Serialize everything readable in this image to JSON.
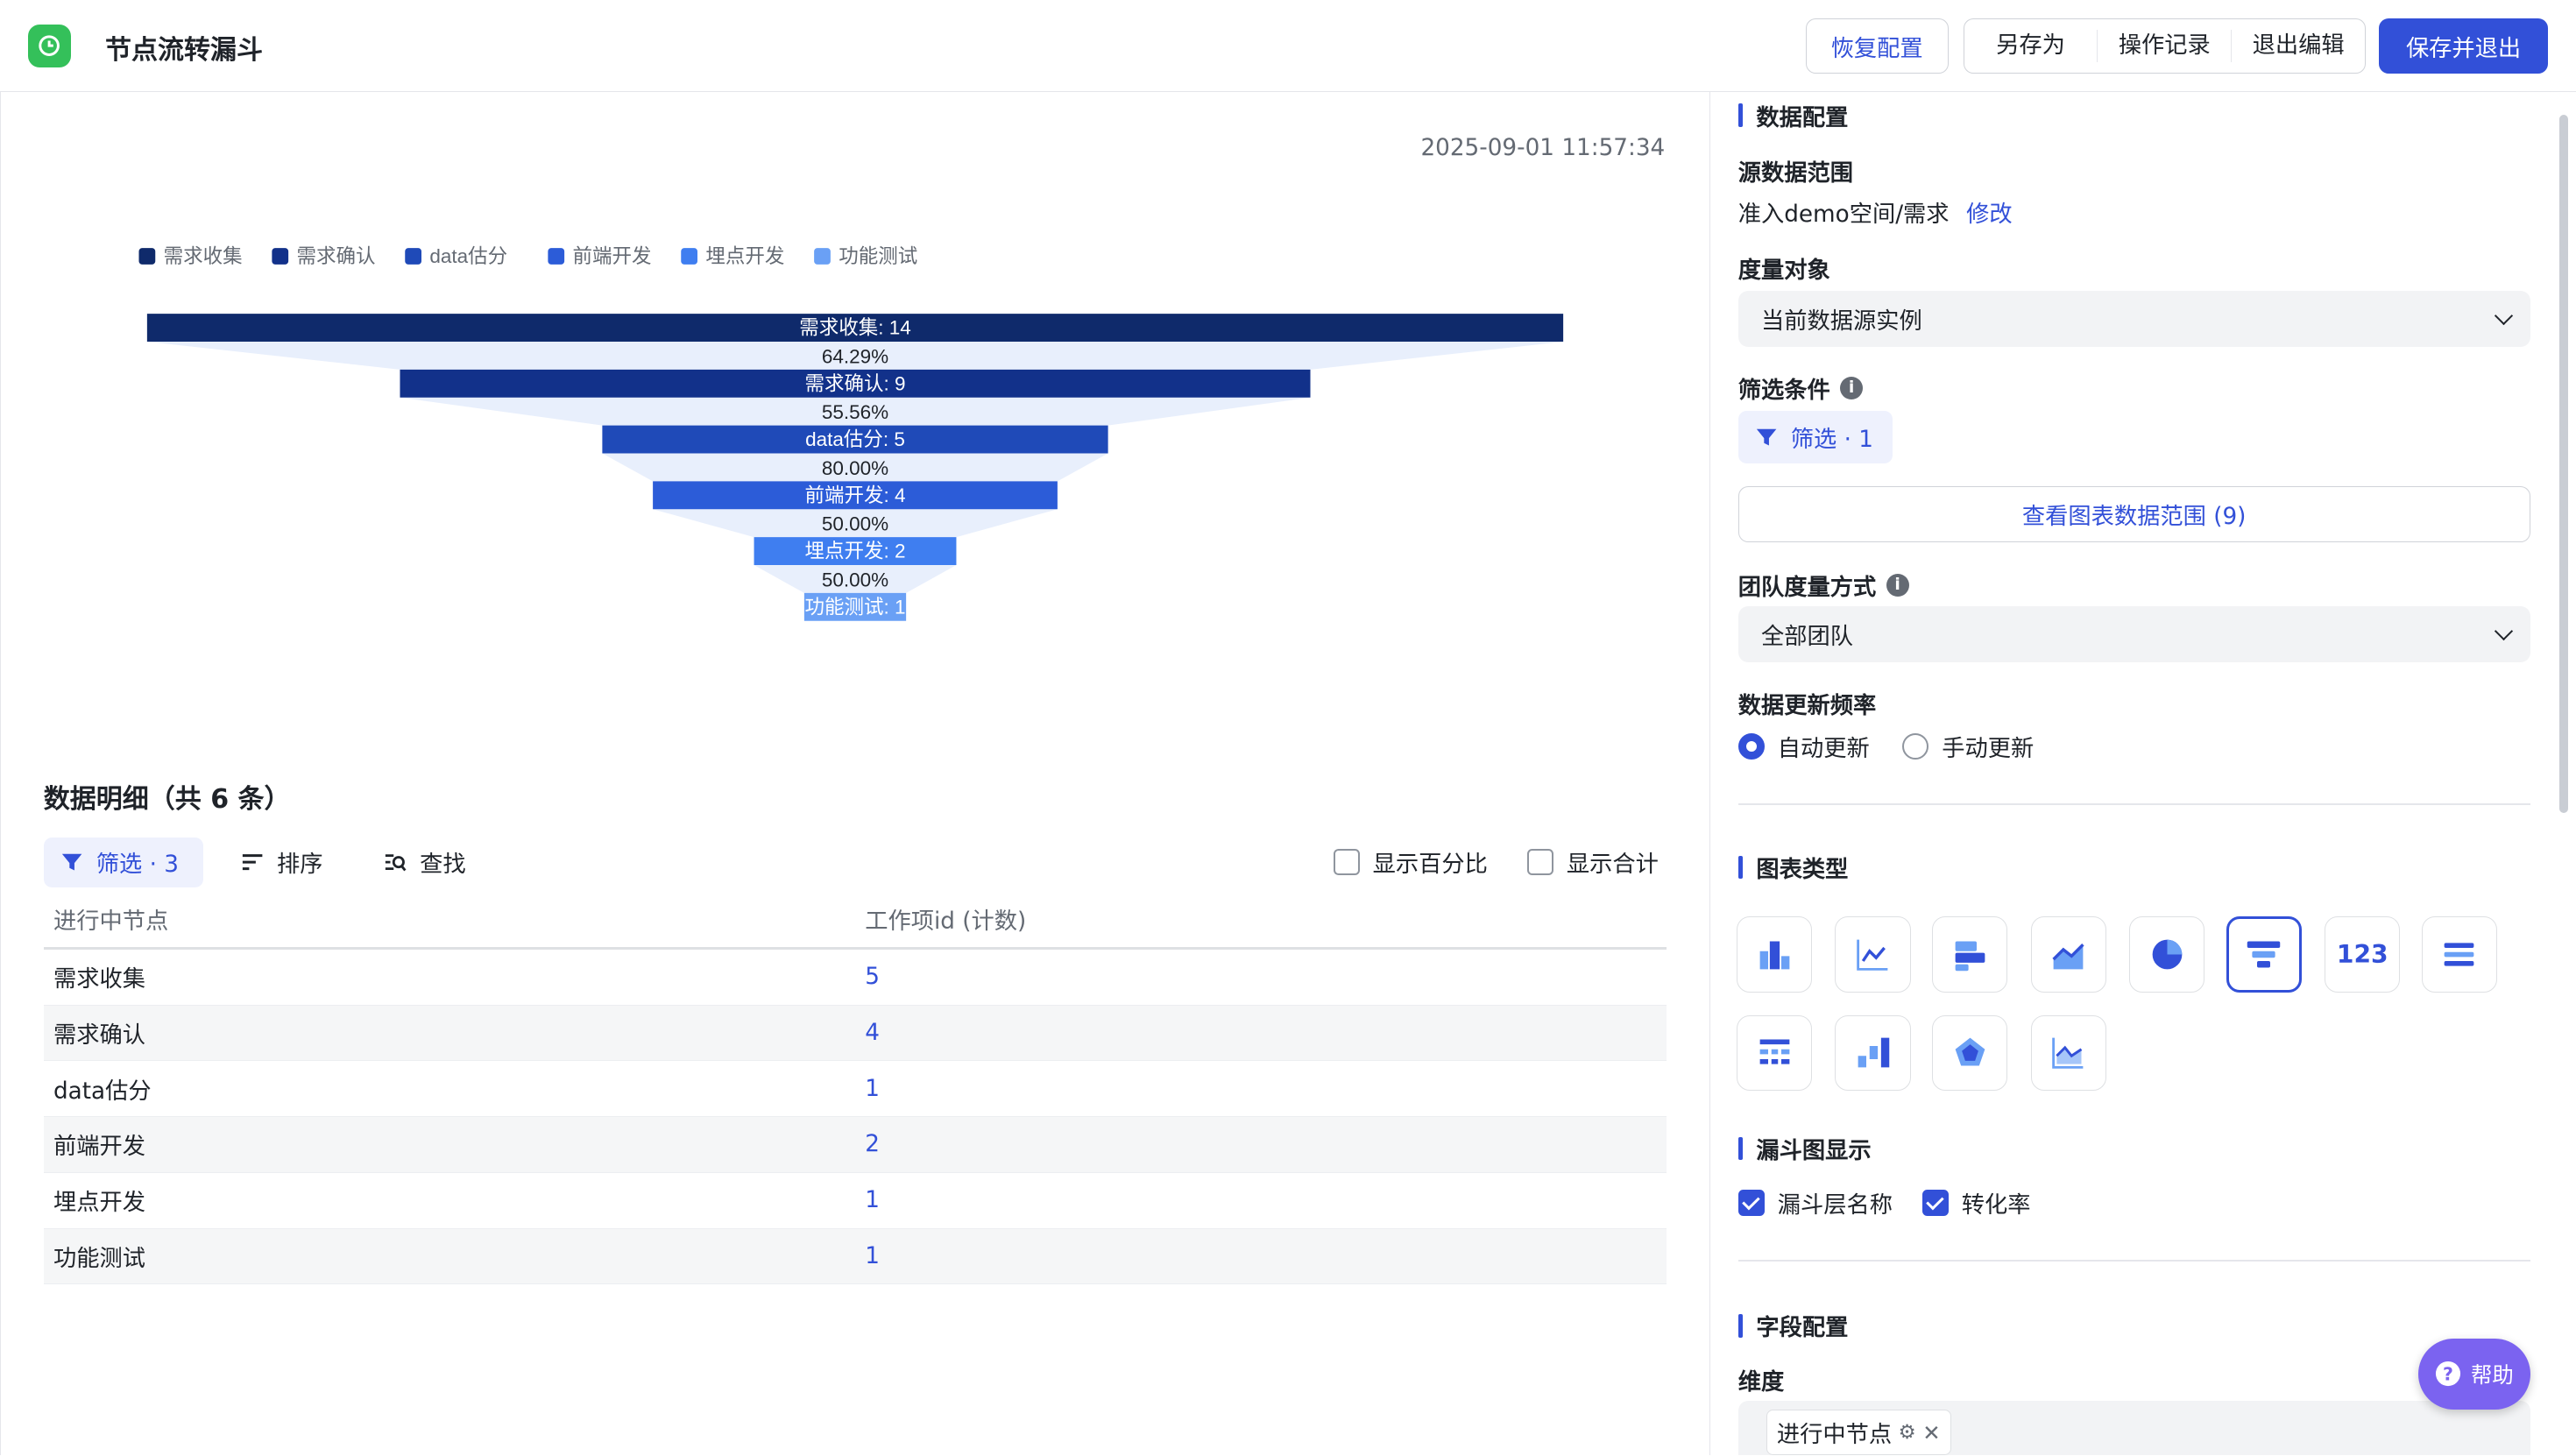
{
  "header": {
    "title": "节点流转漏斗",
    "restore_label": "恢复配置",
    "save_as_label": "另存为",
    "history_label": "操作记录",
    "exit_edit_label": "退出编辑",
    "save_exit_label": "保存并退出"
  },
  "chart": {
    "timestamp": "2025-09-01 11:57:34",
    "legend": [
      "需求收集",
      "需求确认",
      "data估分",
      "前端开发",
      "埋点开发",
      "功能测试"
    ],
    "colors": [
      "#0f2a6b",
      "#12318a",
      "#1f4ab8",
      "#2c5cd8",
      "#3f7ef0",
      "#6aa0f5"
    ],
    "chart_data": {
      "type": "funnel",
      "categories": [
        "需求收集",
        "需求确认",
        "data估分",
        "前端开发",
        "埋点开发",
        "功能测试"
      ],
      "values": [
        14,
        9,
        5,
        4,
        2,
        1
      ],
      "conversion_rates": [
        "64.29%",
        "55.56%",
        "80.00%",
        "50.00%",
        "50.00%"
      ],
      "stage_labels": [
        "需求收集: 14",
        "需求确认: 9",
        "data估分: 5",
        "前端开发: 4",
        "埋点开发: 2",
        "功能测试: 1"
      ]
    }
  },
  "detail": {
    "title": "数据明细（共 6 条）",
    "filter_label": "筛选 · 3",
    "sort_label": "排序",
    "find_label": "查找",
    "show_percent_label": "显示百分比",
    "show_total_label": "显示合计",
    "columns": [
      "进行中节点",
      "工作项id (计数)"
    ],
    "rows": [
      {
        "node": "需求收集",
        "count": "5"
      },
      {
        "node": "需求确认",
        "count": "4"
      },
      {
        "node": "data估分",
        "count": "1"
      },
      {
        "node": "前端开发",
        "count": "2"
      },
      {
        "node": "埋点开发",
        "count": "1"
      },
      {
        "node": "功能测试",
        "count": "1"
      }
    ]
  },
  "config": {
    "data_config_title": "数据配置",
    "source_range_label": "源数据范围",
    "source_range_value": "准入demo空间/需求",
    "modify_label": "修改",
    "measure_label": "度量对象",
    "measure_value": "当前数据源实例",
    "filter_cond_label": "筛选条件",
    "filter_chip_label": "筛选 · 1",
    "view_range_label": "查看图表数据范围 (9)",
    "team_measure_label": "团队度量方式",
    "team_measure_value": "全部团队",
    "update_freq_label": "数据更新频率",
    "auto_update_label": "自动更新",
    "manual_update_label": "手动更新",
    "chart_type_title": "图表类型",
    "chart_type_number_label": "123",
    "funnel_display_title": "漏斗图显示",
    "funnel_layer_name_label": "漏斗层名称",
    "conversion_rate_label": "转化率",
    "field_config_title": "字段配置",
    "dimension_label": "维度",
    "dimension_tag": "进行中节点"
  },
  "help_label": "帮助"
}
